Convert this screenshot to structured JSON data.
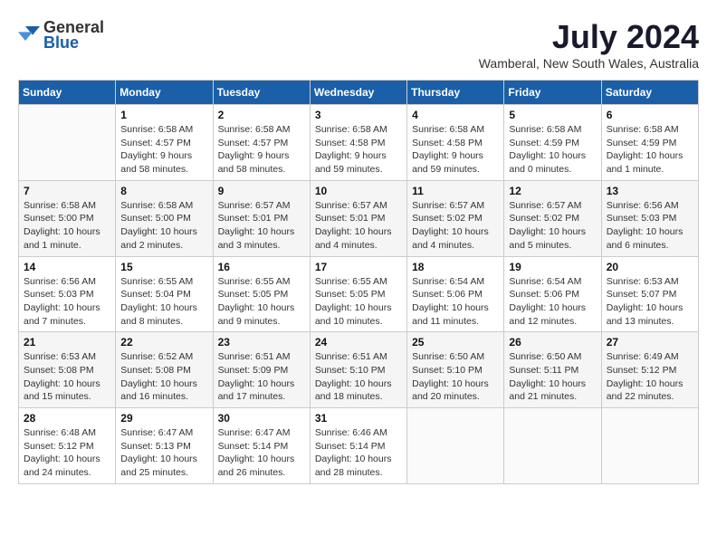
{
  "logo": {
    "general": "General",
    "blue": "Blue"
  },
  "title": "July 2024",
  "location": "Wamberal, New South Wales, Australia",
  "days_header": [
    "Sunday",
    "Monday",
    "Tuesday",
    "Wednesday",
    "Thursday",
    "Friday",
    "Saturday"
  ],
  "weeks": [
    [
      {
        "day": "",
        "info": ""
      },
      {
        "day": "1",
        "info": "Sunrise: 6:58 AM\nSunset: 4:57 PM\nDaylight: 9 hours\nand 58 minutes."
      },
      {
        "day": "2",
        "info": "Sunrise: 6:58 AM\nSunset: 4:57 PM\nDaylight: 9 hours\nand 58 minutes."
      },
      {
        "day": "3",
        "info": "Sunrise: 6:58 AM\nSunset: 4:58 PM\nDaylight: 9 hours\nand 59 minutes."
      },
      {
        "day": "4",
        "info": "Sunrise: 6:58 AM\nSunset: 4:58 PM\nDaylight: 9 hours\nand 59 minutes."
      },
      {
        "day": "5",
        "info": "Sunrise: 6:58 AM\nSunset: 4:59 PM\nDaylight: 10 hours\nand 0 minutes."
      },
      {
        "day": "6",
        "info": "Sunrise: 6:58 AM\nSunset: 4:59 PM\nDaylight: 10 hours\nand 1 minute."
      }
    ],
    [
      {
        "day": "7",
        "info": "Sunrise: 6:58 AM\nSunset: 5:00 PM\nDaylight: 10 hours\nand 1 minute."
      },
      {
        "day": "8",
        "info": "Sunrise: 6:58 AM\nSunset: 5:00 PM\nDaylight: 10 hours\nand 2 minutes."
      },
      {
        "day": "9",
        "info": "Sunrise: 6:57 AM\nSunset: 5:01 PM\nDaylight: 10 hours\nand 3 minutes."
      },
      {
        "day": "10",
        "info": "Sunrise: 6:57 AM\nSunset: 5:01 PM\nDaylight: 10 hours\nand 4 minutes."
      },
      {
        "day": "11",
        "info": "Sunrise: 6:57 AM\nSunset: 5:02 PM\nDaylight: 10 hours\nand 4 minutes."
      },
      {
        "day": "12",
        "info": "Sunrise: 6:57 AM\nSunset: 5:02 PM\nDaylight: 10 hours\nand 5 minutes."
      },
      {
        "day": "13",
        "info": "Sunrise: 6:56 AM\nSunset: 5:03 PM\nDaylight: 10 hours\nand 6 minutes."
      }
    ],
    [
      {
        "day": "14",
        "info": "Sunrise: 6:56 AM\nSunset: 5:03 PM\nDaylight: 10 hours\nand 7 minutes."
      },
      {
        "day": "15",
        "info": "Sunrise: 6:55 AM\nSunset: 5:04 PM\nDaylight: 10 hours\nand 8 minutes."
      },
      {
        "day": "16",
        "info": "Sunrise: 6:55 AM\nSunset: 5:05 PM\nDaylight: 10 hours\nand 9 minutes."
      },
      {
        "day": "17",
        "info": "Sunrise: 6:55 AM\nSunset: 5:05 PM\nDaylight: 10 hours\nand 10 minutes."
      },
      {
        "day": "18",
        "info": "Sunrise: 6:54 AM\nSunset: 5:06 PM\nDaylight: 10 hours\nand 11 minutes."
      },
      {
        "day": "19",
        "info": "Sunrise: 6:54 AM\nSunset: 5:06 PM\nDaylight: 10 hours\nand 12 minutes."
      },
      {
        "day": "20",
        "info": "Sunrise: 6:53 AM\nSunset: 5:07 PM\nDaylight: 10 hours\nand 13 minutes."
      }
    ],
    [
      {
        "day": "21",
        "info": "Sunrise: 6:53 AM\nSunset: 5:08 PM\nDaylight: 10 hours\nand 15 minutes."
      },
      {
        "day": "22",
        "info": "Sunrise: 6:52 AM\nSunset: 5:08 PM\nDaylight: 10 hours\nand 16 minutes."
      },
      {
        "day": "23",
        "info": "Sunrise: 6:51 AM\nSunset: 5:09 PM\nDaylight: 10 hours\nand 17 minutes."
      },
      {
        "day": "24",
        "info": "Sunrise: 6:51 AM\nSunset: 5:10 PM\nDaylight: 10 hours\nand 18 minutes."
      },
      {
        "day": "25",
        "info": "Sunrise: 6:50 AM\nSunset: 5:10 PM\nDaylight: 10 hours\nand 20 minutes."
      },
      {
        "day": "26",
        "info": "Sunrise: 6:50 AM\nSunset: 5:11 PM\nDaylight: 10 hours\nand 21 minutes."
      },
      {
        "day": "27",
        "info": "Sunrise: 6:49 AM\nSunset: 5:12 PM\nDaylight: 10 hours\nand 22 minutes."
      }
    ],
    [
      {
        "day": "28",
        "info": "Sunrise: 6:48 AM\nSunset: 5:12 PM\nDaylight: 10 hours\nand 24 minutes."
      },
      {
        "day": "29",
        "info": "Sunrise: 6:47 AM\nSunset: 5:13 PM\nDaylight: 10 hours\nand 25 minutes."
      },
      {
        "day": "30",
        "info": "Sunrise: 6:47 AM\nSunset: 5:14 PM\nDaylight: 10 hours\nand 26 minutes."
      },
      {
        "day": "31",
        "info": "Sunrise: 6:46 AM\nSunset: 5:14 PM\nDaylight: 10 hours\nand 28 minutes."
      },
      {
        "day": "",
        "info": ""
      },
      {
        "day": "",
        "info": ""
      },
      {
        "day": "",
        "info": ""
      }
    ]
  ]
}
